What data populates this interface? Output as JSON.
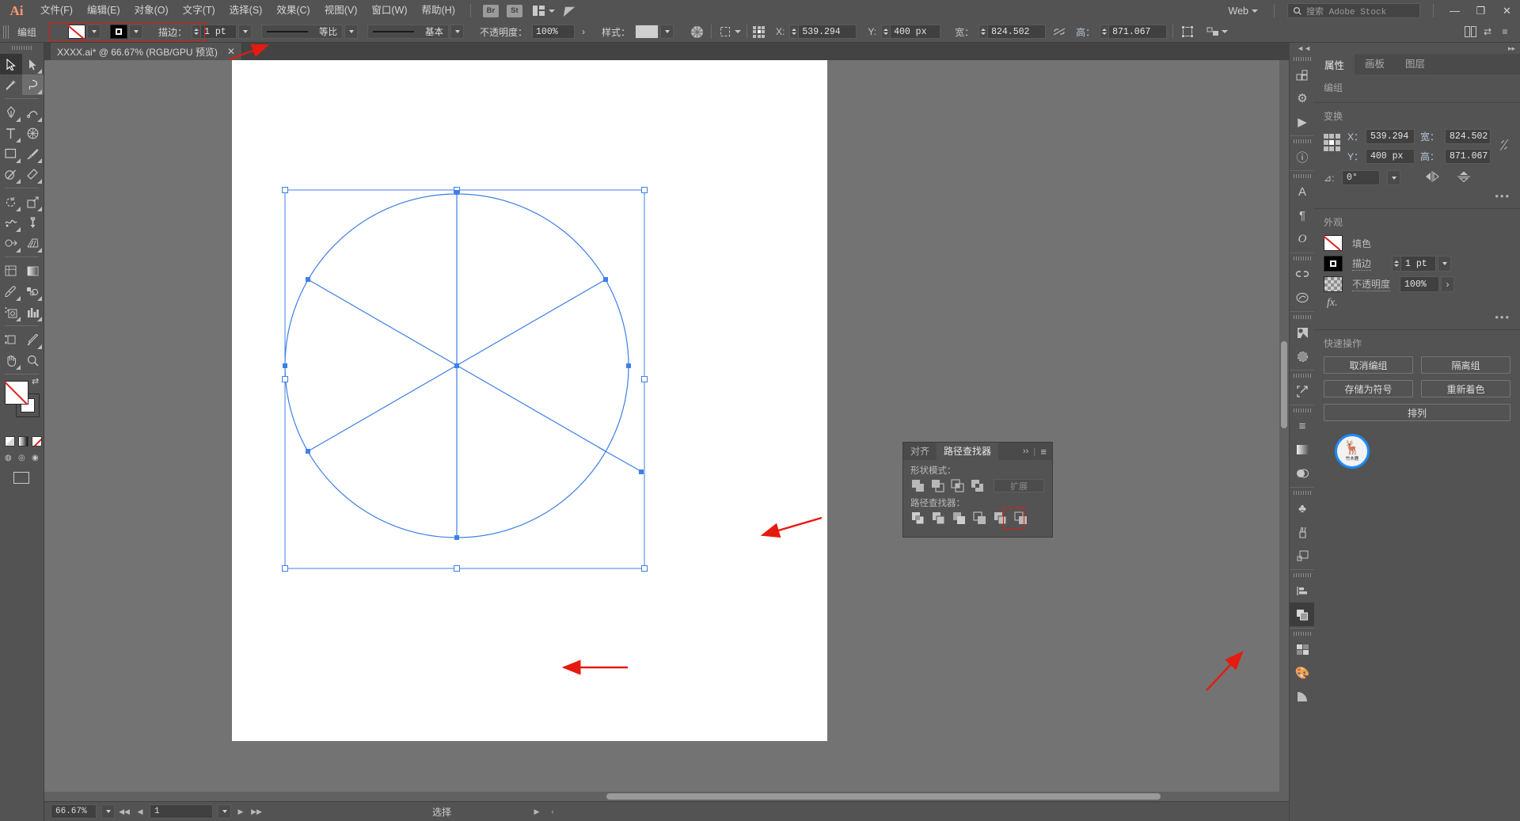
{
  "app": {
    "name": "Adobe Illustrator",
    "logo": "Ai"
  },
  "menubar": {
    "items": [
      "文件(F)",
      "编辑(E)",
      "对象(O)",
      "文字(T)",
      "选择(S)",
      "效果(C)",
      "视图(V)",
      "窗口(W)",
      "帮助(H)"
    ],
    "bridge_label": "Br",
    "stock_label": "St",
    "arrange_icon": "arrange-layout-icon",
    "goto_icon": "goto-illustrator-icon",
    "workspace": "Web",
    "search_placeholder": "搜索 Adobe Stock",
    "window_controls": {
      "minimize": "—",
      "restore": "❐",
      "close": "✕"
    }
  },
  "controlbar": {
    "selection_label": "编组",
    "fill_swatch": "none-fill-swatch",
    "stroke_swatch": "black-stroke-swatch",
    "stroke_label": "描边：",
    "stroke_weight": "1 pt",
    "stroke_profile": "等比",
    "brush_definition": "基本",
    "opacity_label": "不透明度：",
    "opacity_value": "100%",
    "style_label": "样式：",
    "transform": {
      "x_label": "X:",
      "x_value": "539.294",
      "y_label": "Y:",
      "y_value": "400 px",
      "w_label": "宽：",
      "w_value": "824.502",
      "h_label": "高：",
      "h_value": "871.067",
      "unit_suffix": "px"
    }
  },
  "toolbar": {
    "tools": [
      "selection-tool",
      "direct-selection-tool",
      "magic-wand-tool",
      "lasso-tool",
      "pen-tool",
      "curvature-tool",
      "type-tool",
      "line-segment-tool",
      "rectangle-tool",
      "paintbrush-tool",
      "shaper-tool",
      "eraser-tool",
      "rotate-tool",
      "scale-tool",
      "width-tool",
      "free-transform-tool",
      "shape-builder-tool",
      "perspective-grid-tool",
      "mesh-tool",
      "gradient-tool",
      "eyedropper-tool",
      "blend-tool",
      "symbol-sprayer-tool",
      "column-graph-tool",
      "artboard-tool",
      "slice-tool",
      "hand-tool",
      "zoom-tool"
    ],
    "fill_stroke": {
      "fill": "none",
      "stroke": "white"
    }
  },
  "document": {
    "tab_title": "XXXX.ai* @ 66.67% (RGB/GPU 预览)",
    "close_glyph": "✕"
  },
  "properties_panel": {
    "tabs": [
      "属性",
      "画板",
      "图层"
    ],
    "active_tab": "属性",
    "object_type": "编组",
    "transform": {
      "title": "变换",
      "x_label": "X：",
      "x_value": "539.294",
      "y_label": "Y：",
      "y_value": "400 px",
      "w_label": "宽：",
      "w_value": "824.502",
      "h_label": "高：",
      "h_value": "871.067",
      "angle_label": "⊿:",
      "angle_value": "0°",
      "link_icon": "constrain-proportions-icon",
      "flip_h_icon": "flip-horizontal-icon",
      "flip_v_icon": "flip-vertical-icon",
      "more_options": "•••"
    },
    "appearance": {
      "title": "外观",
      "fill_label": "填色",
      "stroke_label": "描边",
      "stroke_value": "1 pt",
      "opacity_label": "不透明度",
      "opacity_value": "100%",
      "fx_label": "fx.",
      "more_options": "•••"
    },
    "quick_actions": {
      "title": "快速操作",
      "buttons": [
        "取消编组",
        "隔离组",
        "存储为符号",
        "重新着色",
        "排列"
      ]
    }
  },
  "dock_icons": [
    "properties-icon",
    "actions-icon",
    "play-icon",
    "info-icon",
    "character-icon",
    "paragraph-icon",
    "glyphs-icon",
    "links-icon",
    "creative-cloud-icon",
    "image-trace-icon",
    "transparency-icon",
    "export-icon",
    "separator-icon",
    "layers-icon",
    "gradient-icon",
    "appearance-icon",
    "symbols-icon",
    "brushes-icon",
    "artboards-icon",
    "align-icon",
    "pathfinder-icon",
    "swatches-icon",
    "color-icon",
    "color-guide-icon"
  ],
  "pathfinder_panel": {
    "tabs": [
      "对齐",
      "路径查找器"
    ],
    "active_tab": "路径查找器",
    "collapse_glyph": "››",
    "menu_glyph": "≡",
    "shape_modes_label": "形状模式：",
    "shape_modes": [
      "unite-icon",
      "minus-front-icon",
      "intersect-icon",
      "exclude-icon"
    ],
    "expand_button": "扩展",
    "pathfinders_label": "路径查找器：",
    "pathfinders": [
      "divide-icon",
      "trim-icon",
      "merge-icon",
      "crop-icon",
      "outline-icon",
      "minus-back-icon"
    ],
    "highlighted_index": 4,
    "highlight_color": "#e51b0f"
  },
  "statusbar": {
    "zoom_value": "66.67%",
    "artboard_number": "1",
    "status_text": "选择",
    "nav_first": "◀◀",
    "nav_prev": "◀",
    "nav_next": "▶",
    "nav_last": "▶▶"
  },
  "badge": {
    "icon": "deer-head-icon",
    "text": "竹木鹿",
    "ring_color": "#1e8bff"
  },
  "canvas": {
    "shape": "circle-divided-into-six-sectors",
    "selection_color": "#3f7fe8",
    "zoom": "66.67%"
  },
  "annotations": {
    "color": "#e51b0f",
    "arrows": [
      "points-to-control-bar-stroke-settings",
      "points-to-shape-right-edge",
      "points-to-shape-bottom",
      "points-to-pathfinder-outline-button"
    ],
    "boxes": [
      "control-bar-stroke-group",
      "pathfinder-outline-button"
    ]
  }
}
